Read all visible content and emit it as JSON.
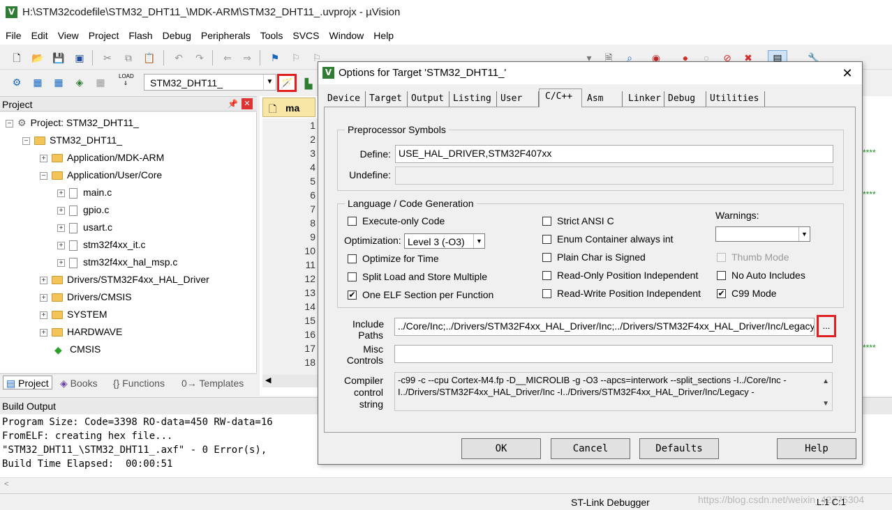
{
  "window": {
    "title": "H:\\STM32codefile\\STM32_DHT11_\\MDK-ARM\\STM32_DHT11_.uvprojx - µVision",
    "icon_letter": "V"
  },
  "menu": [
    "File",
    "Edit",
    "View",
    "Project",
    "Flash",
    "Debug",
    "Peripherals",
    "Tools",
    "SVCS",
    "Window",
    "Help"
  ],
  "toolbar2": {
    "target_name": "STM32_DHT11_",
    "load_label": "LOAD"
  },
  "project_panel": {
    "header": "Project",
    "tree": [
      {
        "label": "Project: STM32_DHT11_",
        "kind": "root"
      },
      {
        "label": "STM32_DHT11_",
        "kind": "target"
      },
      {
        "label": "Application/MDK-ARM",
        "kind": "folder"
      },
      {
        "label": "Application/User/Core",
        "kind": "folder"
      },
      {
        "label": "main.c",
        "kind": "file"
      },
      {
        "label": "gpio.c",
        "kind": "file"
      },
      {
        "label": "usart.c",
        "kind": "file"
      },
      {
        "label": "stm32f4xx_it.c",
        "kind": "file"
      },
      {
        "label": "stm32f4xx_hal_msp.c",
        "kind": "file"
      },
      {
        "label": "Drivers/STM32F4xx_HAL_Driver",
        "kind": "folder"
      },
      {
        "label": "Drivers/CMSIS",
        "kind": "folder"
      },
      {
        "label": "SYSTEM",
        "kind": "folder"
      },
      {
        "label": "HARDWAVE",
        "kind": "folder"
      },
      {
        "label": "CMSIS",
        "kind": "component"
      }
    ],
    "tabs": [
      "Project",
      "Books",
      "{} Functions",
      "0→ Templates"
    ]
  },
  "editor": {
    "tab_label": "ma",
    "line_numbers": [
      "1",
      "2",
      "3",
      "4",
      "5",
      "6",
      "7",
      "8",
      "9",
      "10",
      "11",
      "12",
      "13",
      "14",
      "15",
      "16",
      "17",
      "18"
    ],
    "stars": "****"
  },
  "build_output": {
    "header": "Build Output",
    "lines": [
      "Program Size: Code=3398 RO-data=450 RW-data=16",
      "FromELF: creating hex file...",
      "\"STM32_DHT11_\\STM32_DHT11_.axf\" - 0 Error(s),",
      "Build Time Elapsed:  00:00:51"
    ]
  },
  "statusbar": {
    "debugger": "ST-Link Debugger",
    "position": "L:1 C:1",
    "watermark": "https://blog.csdn.net/weixin_42775304"
  },
  "dialog": {
    "icon_letter": "V",
    "title": "Options for Target 'STM32_DHT11_'",
    "close": "✕",
    "tabs": [
      "Device",
      "Target",
      "Output",
      "Listing",
      "User",
      "C/C++",
      "Asm",
      "Linker",
      "Debug",
      "Utilities"
    ],
    "active_tab": "C/C++",
    "preprocessor": {
      "title": "Preprocessor Symbols",
      "define_label": "Define:",
      "define_value": "USE_HAL_DRIVER,STM32F407xx",
      "undefine_label": "Undefine:",
      "undefine_value": ""
    },
    "language": {
      "title": "Language / Code Generation",
      "execute_only": "Execute-only Code",
      "optimization_label": "Optimization:",
      "optimization_value": "Level 3 (-O3)",
      "optimize_time": "Optimize for Time",
      "split_load": "Split Load and Store Multiple",
      "one_elf": "One ELF Section per Function",
      "strict_ansi": "Strict ANSI C",
      "enum_container": "Enum Container always int",
      "plain_char": "Plain Char is Signed",
      "ro_pi": "Read-Only Position Independent",
      "rw_pi": "Read-Write Position Independent",
      "warnings_label": "Warnings:",
      "warnings_value": "",
      "thumb_mode": "Thumb Mode",
      "no_auto_includes": "No Auto Includes",
      "c99_mode": "C99 Mode"
    },
    "include": {
      "label_1": "Include",
      "label_2": "Paths",
      "value": "../Core/Inc;../Drivers/STM32F4xx_HAL_Driver/Inc;../Drivers/STM32F4xx_HAL_Driver/Inc/Legacy;",
      "browse": "..."
    },
    "misc": {
      "label_1": "Misc",
      "label_2": "Controls",
      "value": ""
    },
    "compiler": {
      "label_1": "Compiler",
      "label_2": "control",
      "label_3": "string",
      "line_1": "-c99 -c --cpu Cortex-M4.fp -D__MICROLIB -g -O3 --apcs=interwork --split_sections -I../Core/Inc -",
      "line_2": "I../Drivers/STM32F4xx_HAL_Driver/Inc -I../Drivers/STM32F4xx_HAL_Driver/Inc/Legacy -"
    },
    "buttons": {
      "ok": "OK",
      "cancel": "Cancel",
      "defaults": "Defaults",
      "help": "Help"
    },
    "checkmark": "✔"
  },
  "colors": {
    "highlight_red": "#e02020",
    "keil_green": "#2e7d32"
  }
}
